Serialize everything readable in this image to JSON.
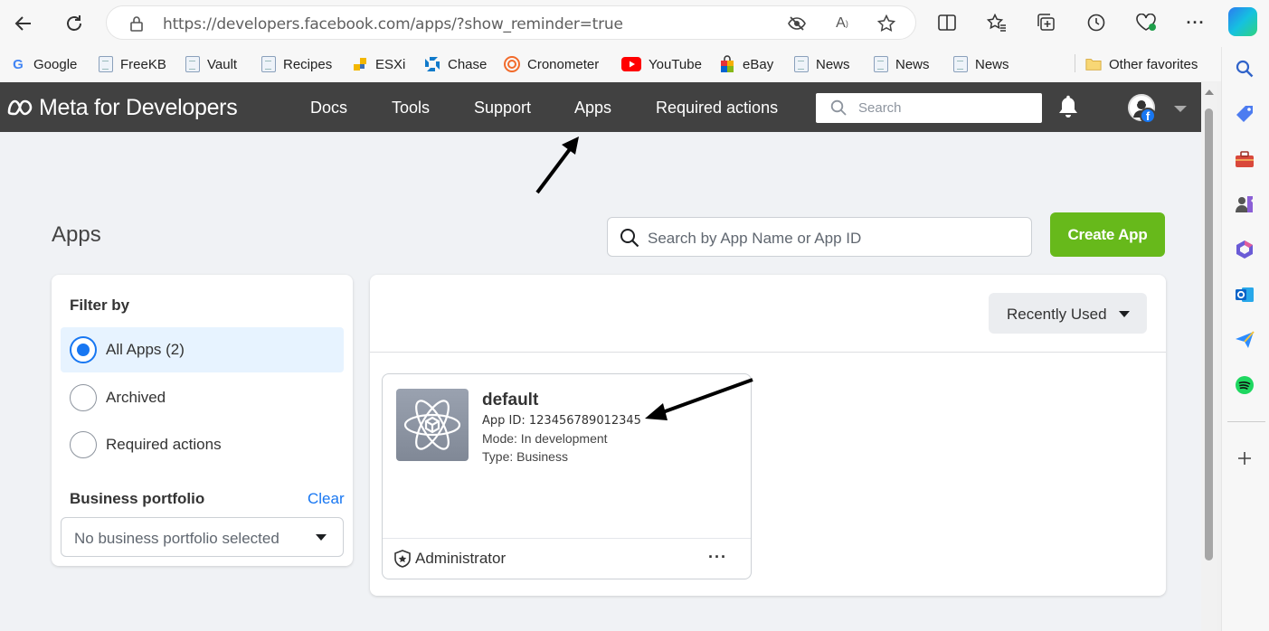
{
  "browser": {
    "url": "https://developers.facebook.com/apps/?show_reminder=true",
    "favorites": [
      {
        "label": "Google",
        "icon": "google-icon"
      },
      {
        "label": "FreeKB",
        "icon": "page-icon"
      },
      {
        "label": "Vault",
        "icon": "page-icon"
      },
      {
        "label": "Recipes",
        "icon": "page-icon"
      },
      {
        "label": "ESXi",
        "icon": "esxi-icon"
      },
      {
        "label": "Chase",
        "icon": "chase-icon"
      },
      {
        "label": "Cronometer",
        "icon": "cronometer-icon"
      },
      {
        "label": "YouTube",
        "icon": "youtube-icon"
      },
      {
        "label": "eBay",
        "icon": "ebay-icon"
      },
      {
        "label": "News",
        "icon": "page-icon"
      },
      {
        "label": "News",
        "icon": "page-icon"
      },
      {
        "label": "News",
        "icon": "page-icon"
      }
    ],
    "other_favorites": "Other favorites"
  },
  "meta_nav": {
    "logo": "Meta for Developers",
    "links": [
      "Docs",
      "Tools",
      "Support",
      "Apps",
      "Required actions"
    ],
    "search_placeholder": "Search"
  },
  "page": {
    "title": "Apps",
    "search_placeholder": "Search by App Name or App ID",
    "create_button": "Create App"
  },
  "filter": {
    "title": "Filter by",
    "options": [
      {
        "label": "All Apps (2)",
        "selected": true
      },
      {
        "label": "Archived",
        "selected": false
      },
      {
        "label": "Required actions",
        "selected": false
      }
    ],
    "business_portfolio_title": "Business portfolio",
    "clear_label": "Clear",
    "portfolio_select_value": "No business portfolio selected"
  },
  "apps_list": {
    "sort_label": "Recently Used",
    "apps": [
      {
        "name": "default",
        "app_id": "App ID: 123456789012345",
        "mode": "Mode: In development",
        "type": "Type: Business",
        "role": "Administrator"
      }
    ]
  },
  "colors": {
    "meta_nav_bg": "#414141",
    "create_button": "#67b91b",
    "accent_blue": "#1877f2",
    "page_bg": "#f0f2f5"
  }
}
